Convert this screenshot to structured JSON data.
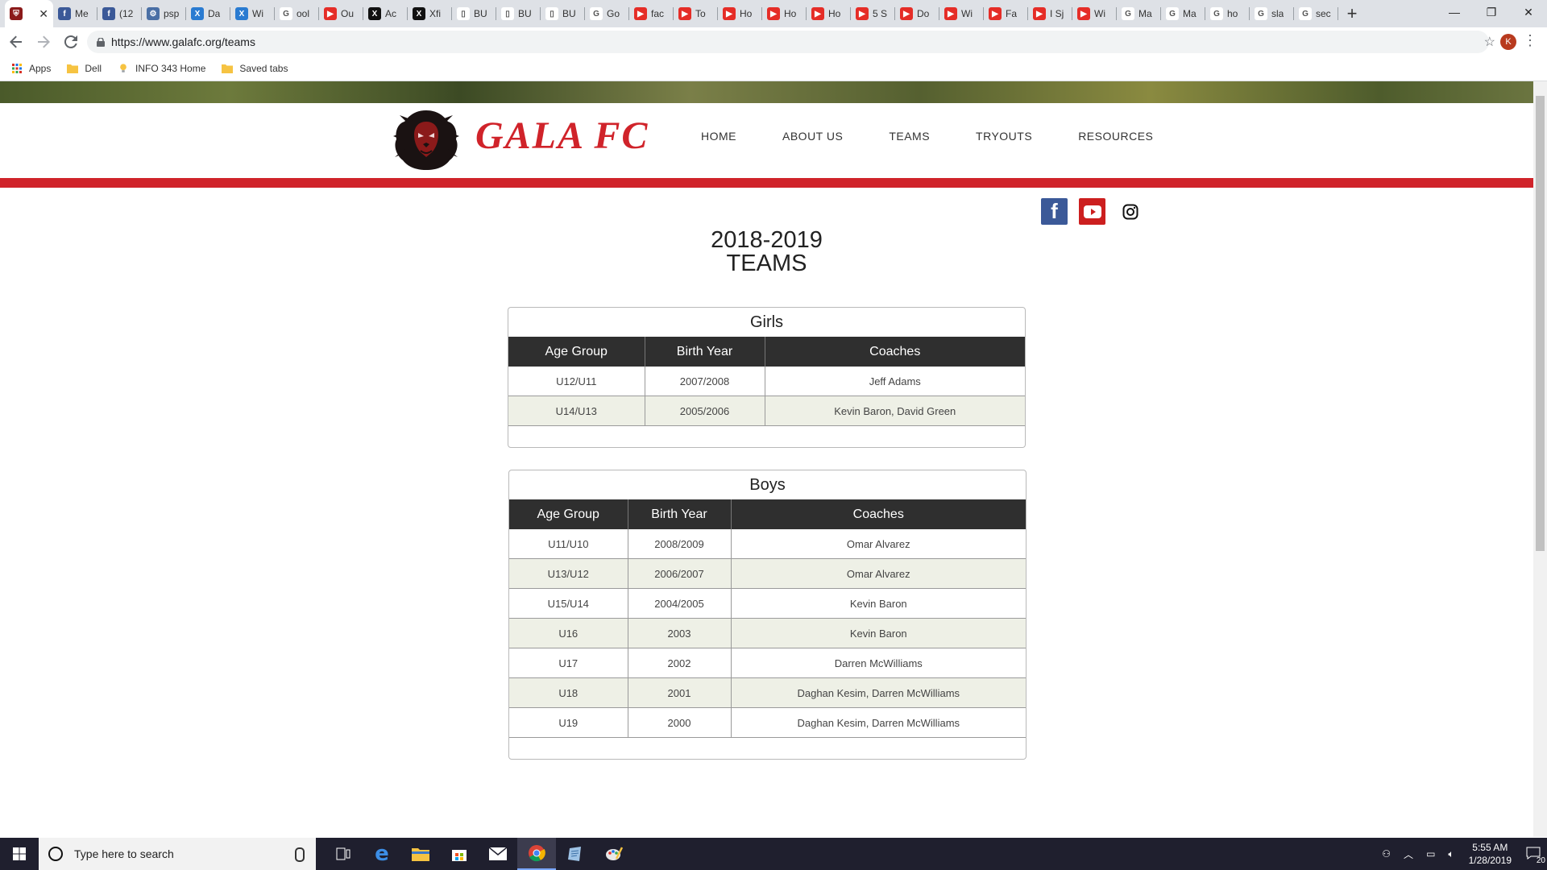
{
  "browser": {
    "tabs": [
      {
        "title": "",
        "color": "#8b1a1a",
        "glyph": "⛨",
        "active": true
      },
      {
        "title": "Me",
        "color": "#3b5998",
        "glyph": "f"
      },
      {
        "title": "(12",
        "color": "#3b5998",
        "glyph": "f"
      },
      {
        "title": "psp",
        "color": "#4a6fa5",
        "glyph": "⚙"
      },
      {
        "title": "Da",
        "color": "#2a7bd1",
        "glyph": "X"
      },
      {
        "title": "Wi",
        "color": "#2a7bd1",
        "glyph": "X"
      },
      {
        "title": "ool",
        "color": "#ffffff",
        "glyph": "G"
      },
      {
        "title": "Ou",
        "color": "#e52d27",
        "glyph": "▶"
      },
      {
        "title": "Ac",
        "color": "#111111",
        "glyph": "X"
      },
      {
        "title": "Xfi",
        "color": "#111111",
        "glyph": "X"
      },
      {
        "title": "BU",
        "color": "#ffffff",
        "glyph": "▯"
      },
      {
        "title": "BU",
        "color": "#ffffff",
        "glyph": "▯"
      },
      {
        "title": "BU",
        "color": "#ffffff",
        "glyph": "▯"
      },
      {
        "title": "Go",
        "color": "#ffffff",
        "glyph": "G"
      },
      {
        "title": "fac",
        "color": "#e52d27",
        "glyph": "▶"
      },
      {
        "title": "To",
        "color": "#e52d27",
        "glyph": "▶"
      },
      {
        "title": "Ho",
        "color": "#e52d27",
        "glyph": "▶"
      },
      {
        "title": "Ho",
        "color": "#e52d27",
        "glyph": "▶"
      },
      {
        "title": "Ho",
        "color": "#e52d27",
        "glyph": "▶"
      },
      {
        "title": "5 S",
        "color": "#e52d27",
        "glyph": "▶"
      },
      {
        "title": "Do",
        "color": "#e52d27",
        "glyph": "▶"
      },
      {
        "title": "Wi",
        "color": "#e52d27",
        "glyph": "▶"
      },
      {
        "title": "Fa",
        "color": "#e52d27",
        "glyph": "▶"
      },
      {
        "title": "I Sj",
        "color": "#e52d27",
        "glyph": "▶"
      },
      {
        "title": "Wi",
        "color": "#e52d27",
        "glyph": "▶"
      },
      {
        "title": "Ma",
        "color": "#ffffff",
        "glyph": "G"
      },
      {
        "title": "Ma",
        "color": "#ffffff",
        "glyph": "G"
      },
      {
        "title": "ho",
        "color": "#ffffff",
        "glyph": "G"
      },
      {
        "title": "sla",
        "color": "#ffffff",
        "glyph": "G"
      },
      {
        "title": "sec",
        "color": "#ffffff",
        "glyph": "G"
      }
    ],
    "url": "https://www.galafc.org/teams",
    "profile_initial": "K",
    "bookmarks": [
      {
        "label": "Apps",
        "icon": "apps-grid-icon"
      },
      {
        "label": "Dell",
        "icon": "folder-icon"
      },
      {
        "label": "INFO 343 Home",
        "icon": "lightbulb-icon"
      },
      {
        "label": "Saved tabs",
        "icon": "folder-icon"
      }
    ]
  },
  "site": {
    "brand": "GALA FC",
    "nav": [
      "HOME",
      "ABOUT US",
      "TEAMS",
      "TRYOUTS",
      "RESOURCES"
    ],
    "title_line1": "2018-2019",
    "title_line2": "TEAMS",
    "colors": {
      "accent_red": "#d0232a",
      "table_header": "#2f2f2f",
      "row_alt": "#eef0e6"
    }
  },
  "girls": {
    "title": "Girls",
    "headers": [
      "Age Group",
      "Birth Year",
      "Coaches"
    ],
    "rows": [
      [
        "U12/U11",
        "2007/2008",
        "Jeff Adams"
      ],
      [
        "U14/U13",
        "2005/2006",
        "Kevin Baron, David Green"
      ]
    ]
  },
  "boys": {
    "title": "Boys",
    "headers": [
      "Age Group",
      "Birth Year",
      "Coaches"
    ],
    "rows": [
      [
        "U11/U10",
        "2008/2009",
        "Omar Alvarez"
      ],
      [
        "U13/U12",
        "2006/2007",
        "Omar Alvarez"
      ],
      [
        "U15/U14",
        "2004/2005",
        "Kevin Baron"
      ],
      [
        "U16",
        "2003",
        "Kevin Baron"
      ],
      [
        "U17",
        "2002",
        "Darren McWilliams"
      ],
      [
        "U18",
        "2001",
        "Daghan Kesim, Darren McWilliams"
      ],
      [
        "U19",
        "2000",
        "Daghan Kesim, Darren McWilliams"
      ]
    ]
  },
  "taskbar": {
    "search_placeholder": "Type here to search",
    "time": "5:55 AM",
    "date": "1/28/2019",
    "notification_count": "20"
  }
}
